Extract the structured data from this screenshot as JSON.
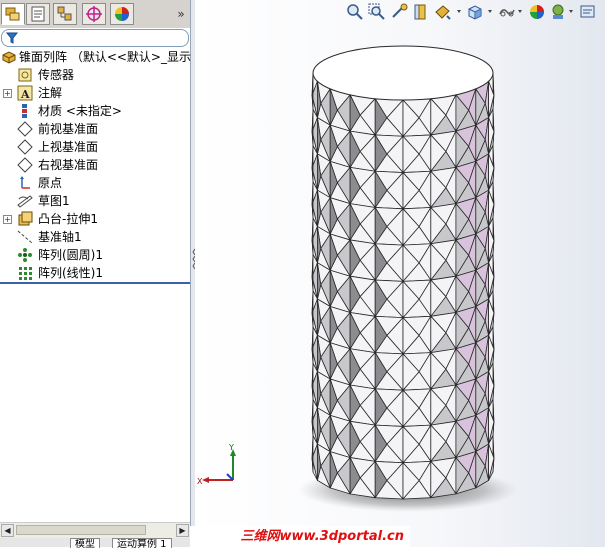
{
  "tree": {
    "root": "锥面列阵 （默认<<默认>_显示状",
    "items": [
      {
        "label": "传感器",
        "icon": "sensor-icon",
        "expandable": false
      },
      {
        "label": "注解",
        "icon": "annotation-icon",
        "expandable": true
      },
      {
        "label": "材质 <未指定>",
        "icon": "material-icon",
        "expandable": false
      },
      {
        "label": "前视基准面",
        "icon": "plane-icon",
        "expandable": false
      },
      {
        "label": "上视基准面",
        "icon": "plane-icon",
        "expandable": false
      },
      {
        "label": "右视基准面",
        "icon": "plane-icon",
        "expandable": false
      },
      {
        "label": "原点",
        "icon": "origin-icon",
        "expandable": false
      },
      {
        "label": "草图1",
        "icon": "sketch-icon",
        "expandable": false
      },
      {
        "label": "凸台-拉伸1",
        "icon": "extrude-icon",
        "expandable": true
      },
      {
        "label": "基准轴1",
        "icon": "axis-icon",
        "expandable": false
      },
      {
        "label": "阵列(圆周)1",
        "icon": "circular-pattern-icon",
        "expandable": false
      },
      {
        "label": "阵列(线性)1",
        "icon": "linear-pattern-icon",
        "expandable": false
      }
    ]
  },
  "panel": {
    "expand_glyph": "»",
    "bottom_tabs": [
      "模型",
      "运动算例 1"
    ]
  },
  "triad": {
    "x": "X",
    "y": "Y"
  },
  "watermark": "三维网www.3dportal.cn",
  "colors": {
    "accent_blue": "#3b62a8",
    "face_light": "#f4f4f6",
    "face_mid": "#c8c8cc",
    "face_dark": "#8c8c90",
    "face_tint": "#d9c2dc",
    "watermark": "#e01010"
  }
}
